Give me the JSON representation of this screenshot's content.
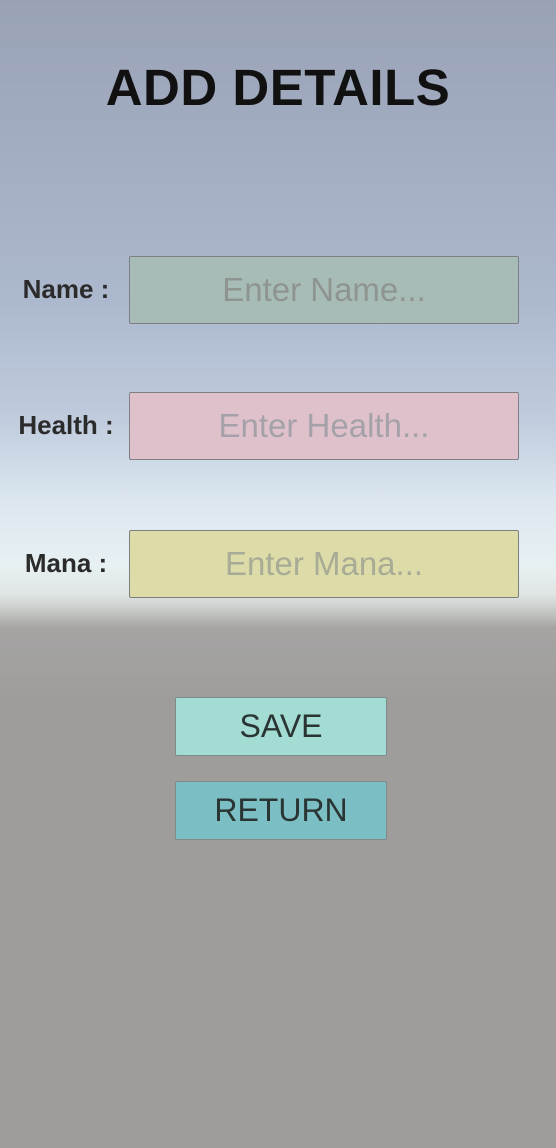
{
  "header": {
    "title": "ADD DETAILS"
  },
  "form": {
    "name": {
      "label": "Name :",
      "placeholder": "Enter Name..."
    },
    "health": {
      "label": "Health :",
      "placeholder": "Enter Health..."
    },
    "mana": {
      "label": "Mana :",
      "placeholder": "Enter Mana..."
    }
  },
  "actions": {
    "save_label": "SAVE",
    "return_label": "RETURN"
  },
  "colors": {
    "name_field": "#a8bcb7",
    "health_field": "#dfc1cc",
    "mana_field": "#dddca8",
    "save_button": "#a3dcd2",
    "return_button": "#7bbfc4"
  }
}
